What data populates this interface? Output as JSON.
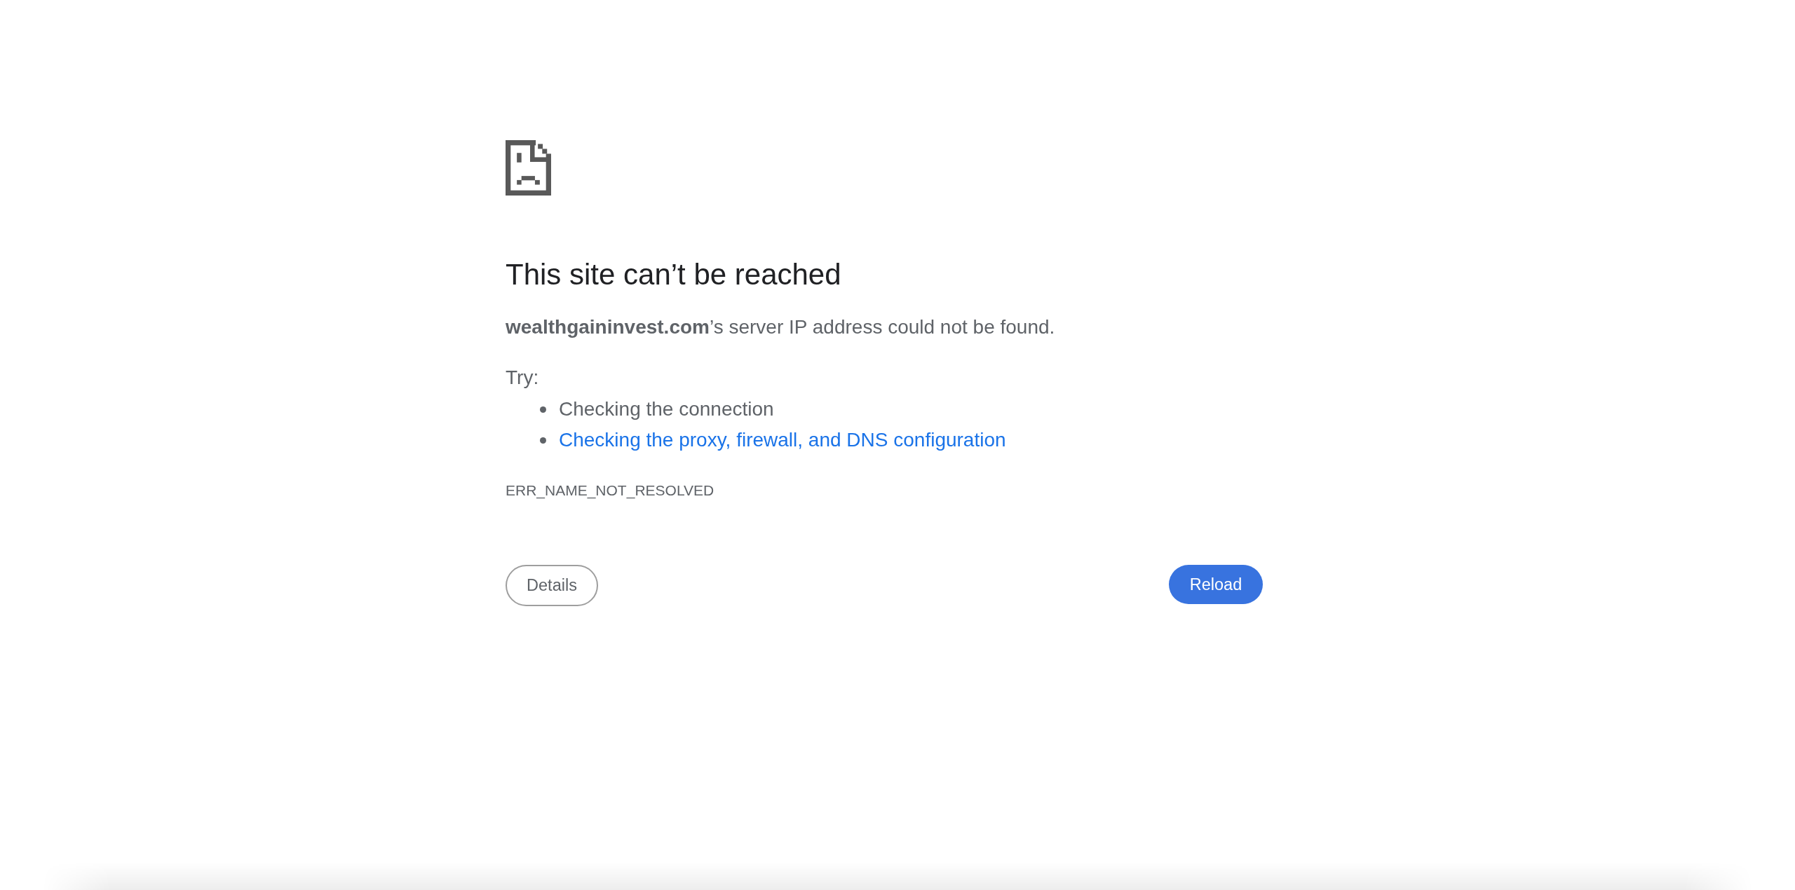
{
  "error": {
    "title": "This site can’t be reached",
    "message": "**wealthgaininvest.com**’s server IP address could not be found.",
    "try_label": "Try:",
    "suggestions": [
      {
        "kind": "text",
        "text": "Checking the connection"
      },
      {
        "kind": "link",
        "text": "Checking the proxy, firewall, and DNS configuration"
      }
    ],
    "error_code": "ERR_NAME_NOT_RESOLVED"
  },
  "buttons": {
    "details": "Details",
    "reload": "Reload"
  }
}
